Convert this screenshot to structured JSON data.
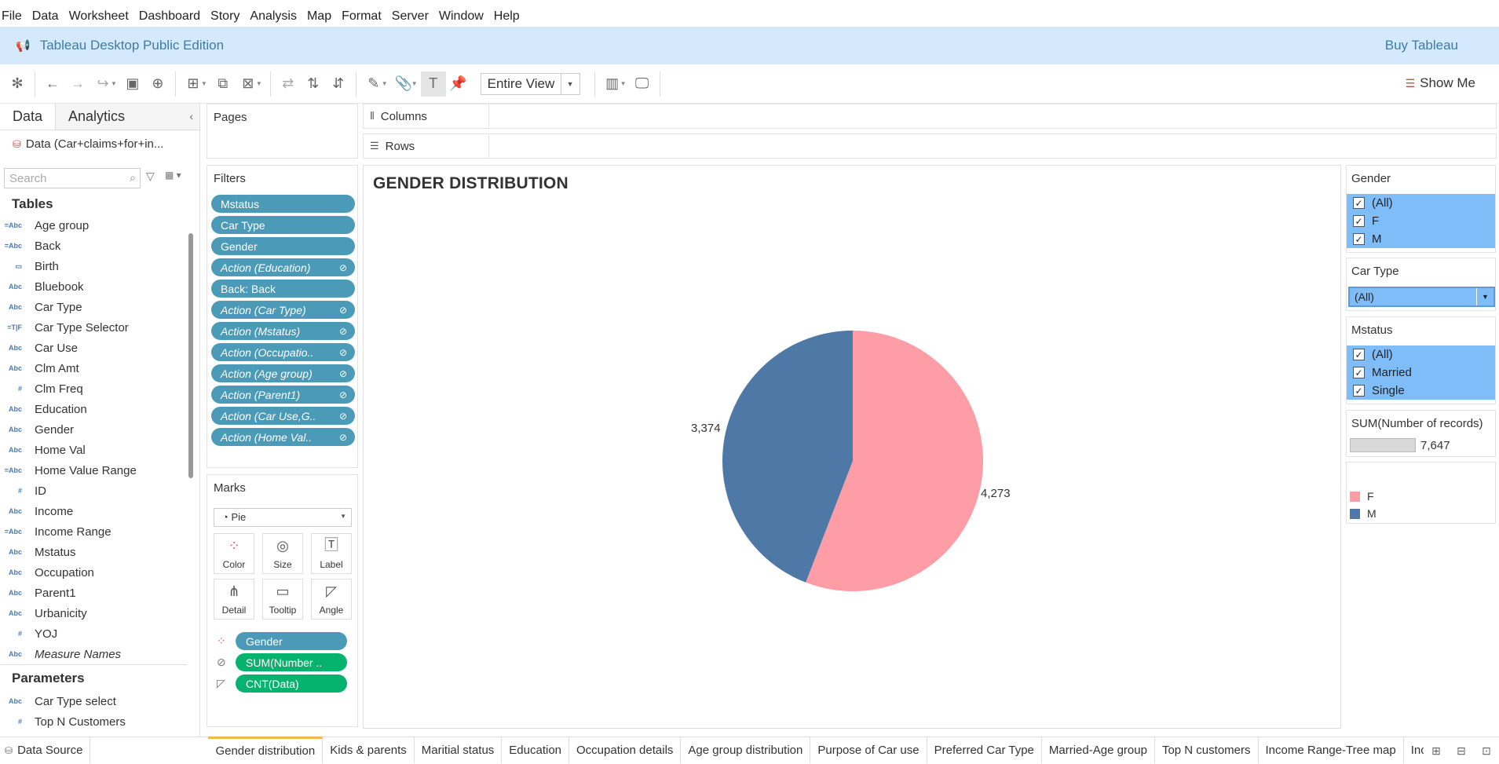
{
  "menu": [
    "File",
    "Data",
    "Worksheet",
    "Dashboard",
    "Story",
    "Analysis",
    "Map",
    "Format",
    "Server",
    "Window",
    "Help"
  ],
  "banner": {
    "title": "Tableau Desktop Public Edition",
    "buy": "Buy Tableau"
  },
  "toolbar": {
    "view": "Entire View",
    "show_me": "Show Me"
  },
  "datapane": {
    "tab_data": "Data",
    "tab_analytics": "Analytics",
    "datasource": "Data (Car+claims+for+in...",
    "search_placeholder": "Search",
    "tables_heading": "Tables",
    "fields": [
      {
        "type": "=Abc",
        "name": "Age group",
        "italic": false
      },
      {
        "type": "=Abc",
        "name": "Back",
        "italic": false
      },
      {
        "type": "▭",
        "name": "Birth",
        "italic": false
      },
      {
        "type": "Abc",
        "name": "Bluebook",
        "italic": false
      },
      {
        "type": "Abc",
        "name": "Car Type",
        "italic": false
      },
      {
        "type": "=T|F",
        "name": "Car Type Selector",
        "italic": false
      },
      {
        "type": "Abc",
        "name": "Car Use",
        "italic": false
      },
      {
        "type": "Abc",
        "name": "Clm Amt",
        "italic": false
      },
      {
        "type": "#",
        "name": "Clm Freq",
        "italic": false
      },
      {
        "type": "Abc",
        "name": "Education",
        "italic": false
      },
      {
        "type": "Abc",
        "name": "Gender",
        "italic": false
      },
      {
        "type": "Abc",
        "name": "Home Val",
        "italic": false
      },
      {
        "type": "=Abc",
        "name": "Home Value Range",
        "italic": false
      },
      {
        "type": "#",
        "name": "ID",
        "italic": false
      },
      {
        "type": "Abc",
        "name": "Income",
        "italic": false
      },
      {
        "type": "=Abc",
        "name": "Income Range",
        "italic": false
      },
      {
        "type": "Abc",
        "name": "Mstatus",
        "italic": false
      },
      {
        "type": "Abc",
        "name": "Occupation",
        "italic": false
      },
      {
        "type": "Abc",
        "name": "Parent1",
        "italic": false
      },
      {
        "type": "Abc",
        "name": "Urbanicity",
        "italic": false
      },
      {
        "type": "#",
        "name": "YOJ",
        "italic": false
      },
      {
        "type": "Abc",
        "name": "Measure Names",
        "italic": true
      }
    ],
    "parameters_heading": "Parameters",
    "parameters": [
      {
        "type": "Abc",
        "name": "Car Type select"
      },
      {
        "type": "#",
        "name": "Top N Customers"
      }
    ]
  },
  "pages_title": "Pages",
  "filters": {
    "title": "Filters",
    "pills": [
      {
        "label": "Mstatus",
        "italic": false,
        "link": false
      },
      {
        "label": "Car Type",
        "italic": false,
        "link": false
      },
      {
        "label": "Gender",
        "italic": false,
        "link": false
      },
      {
        "label": "Action (Education)",
        "italic": true,
        "link": true
      },
      {
        "label": "Back: Back",
        "italic": false,
        "link": false
      },
      {
        "label": "Action (Car Type)",
        "italic": true,
        "link": true
      },
      {
        "label": "Action (Mstatus)",
        "italic": true,
        "link": true
      },
      {
        "label": "Action (Occupatio..",
        "italic": true,
        "link": true
      },
      {
        "label": "Action (Age group)",
        "italic": true,
        "link": true
      },
      {
        "label": "Action (Parent1)",
        "italic": true,
        "link": true
      },
      {
        "label": "Action (Car Use,G..",
        "italic": true,
        "link": true
      },
      {
        "label": "Action (Home Val..",
        "italic": true,
        "link": true
      }
    ]
  },
  "marks": {
    "title": "Marks",
    "type": "Pie",
    "buttons": [
      "Color",
      "Size",
      "Label",
      "Detail",
      "Tooltip",
      "Angle"
    ],
    "pills": [
      {
        "label": "Gender",
        "kind": "blue",
        "icon": "color-icon"
      },
      {
        "label": "SUM(Number ..",
        "kind": "green",
        "icon": "size-icon"
      },
      {
        "label": "CNT(Data)",
        "kind": "green",
        "icon": "angle-icon"
      }
    ]
  },
  "shelves": {
    "columns": "Columns",
    "rows": "Rows"
  },
  "sheet_title": "GENDER DISTRIBUTION",
  "chart_data": {
    "type": "pie",
    "title": "GENDER DISTRIBUTION",
    "categories": [
      "F",
      "M"
    ],
    "values": [
      4273,
      3374
    ],
    "labels": [
      "4,273",
      "3,374"
    ],
    "colors": [
      "#ff9da7",
      "#4e79a7"
    ]
  },
  "legends": {
    "gender": {
      "title": "Gender",
      "items": [
        "(All)",
        "F",
        "M"
      ]
    },
    "car_type": {
      "title": "Car Type",
      "value": "(All)"
    },
    "mstatus": {
      "title": "Mstatus",
      "items": [
        "(All)",
        "Married",
        "Single"
      ]
    },
    "sum_records": {
      "title": "SUM(Number of records)",
      "value": "7,647"
    },
    "color_legend": {
      "items": [
        {
          "label": "F",
          "color": "#ff9da7"
        },
        {
          "label": "M",
          "color": "#4e79a7"
        }
      ]
    }
  },
  "sheet_tabs": {
    "datasource": "Data Source",
    "tabs": [
      "Gender distribution",
      "Kids & parents",
      "Maritial status",
      "Education",
      "Occupation details",
      "Age group distribution",
      "Purpose of Car use",
      "Preferred Car Type",
      "Married-Age group",
      "Top N customers",
      "Income Range-Tree map",
      "Income R"
    ],
    "active": 0
  }
}
